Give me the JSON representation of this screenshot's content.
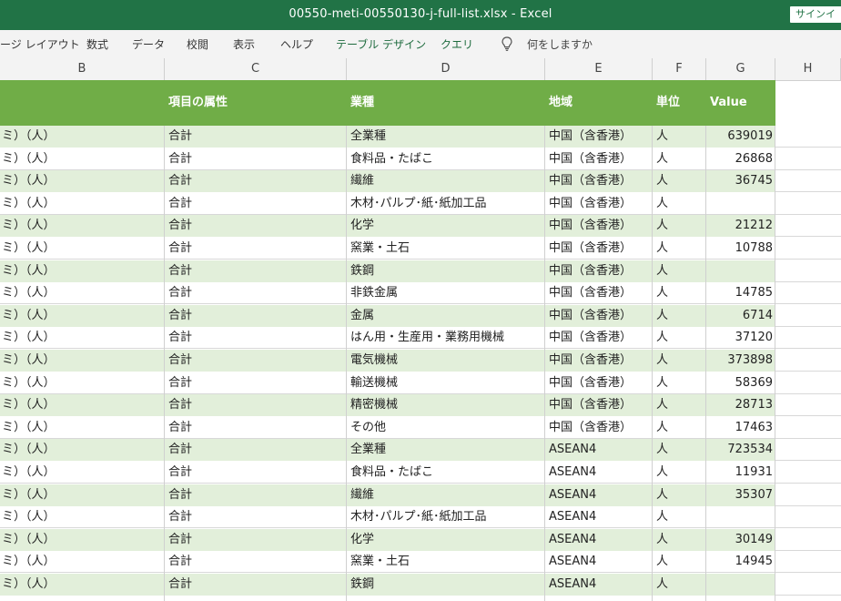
{
  "window": {
    "title": "00550-meti-00550130-j-full-list.xlsx  -  Excel",
    "signin_label": "サインイ"
  },
  "ribbon": {
    "tabs": [
      "ージ レイアウト",
      "数式",
      "データ",
      "校閲",
      "表示",
      "ヘルプ",
      "テーブル デザイン",
      "クエリ"
    ],
    "tell_me": "何をしますか",
    "lightbulb_icon": "lightbulb-icon"
  },
  "columns": [
    "B",
    "C",
    "D",
    "E",
    "F",
    "G",
    "H"
  ],
  "table": {
    "headers": {
      "attr": "項目の属性",
      "industry": "業種",
      "region": "地域",
      "unit": "単位",
      "value": "Value"
    },
    "rows": [
      {
        "b": "ミ）（人）",
        "c": "合計",
        "d": "全業種",
        "e": "中国（含香港）",
        "f": "人",
        "g": "639019"
      },
      {
        "b": "ミ）（人）",
        "c": "合計",
        "d": "食料品・たばこ",
        "e": "中国（含香港）",
        "f": "人",
        "g": "26868"
      },
      {
        "b": "ミ）（人）",
        "c": "合計",
        "d": "繊維",
        "e": "中国（含香港）",
        "f": "人",
        "g": "36745"
      },
      {
        "b": "ミ）（人）",
        "c": "合計",
        "d": "木材･パルプ･紙･紙加工品",
        "e": "中国（含香港）",
        "f": "人",
        "g": ""
      },
      {
        "b": "ミ）（人）",
        "c": "合計",
        "d": "化学",
        "e": "中国（含香港）",
        "f": "人",
        "g": "21212"
      },
      {
        "b": "ミ）（人）",
        "c": "合計",
        "d": "窯業・土石",
        "e": "中国（含香港）",
        "f": "人",
        "g": "10788"
      },
      {
        "b": "ミ）（人）",
        "c": "合計",
        "d": "鉄鋼",
        "e": "中国（含香港）",
        "f": "人",
        "g": ""
      },
      {
        "b": "ミ）（人）",
        "c": "合計",
        "d": "非鉄金属",
        "e": "中国（含香港）",
        "f": "人",
        "g": "14785"
      },
      {
        "b": "ミ）（人）",
        "c": "合計",
        "d": "金属",
        "e": "中国（含香港）",
        "f": "人",
        "g": "6714"
      },
      {
        "b": "ミ）（人）",
        "c": "合計",
        "d": "はん用・生産用・業務用機械",
        "e": "中国（含香港）",
        "f": "人",
        "g": "37120"
      },
      {
        "b": "ミ）（人）",
        "c": "合計",
        "d": "電気機械",
        "e": "中国（含香港）",
        "f": "人",
        "g": "373898"
      },
      {
        "b": "ミ）（人）",
        "c": "合計",
        "d": "輸送機械",
        "e": "中国（含香港）",
        "f": "人",
        "g": "58369"
      },
      {
        "b": "ミ）（人）",
        "c": "合計",
        "d": "精密機械",
        "e": "中国（含香港）",
        "f": "人",
        "g": "28713"
      },
      {
        "b": "ミ）（人）",
        "c": "合計",
        "d": "その他",
        "e": "中国（含香港）",
        "f": "人",
        "g": "17463"
      },
      {
        "b": "ミ）（人）",
        "c": "合計",
        "d": "全業種",
        "e": "ASEAN4",
        "f": "人",
        "g": "723534"
      },
      {
        "b": "ミ）（人）",
        "c": "合計",
        "d": "食料品・たばこ",
        "e": "ASEAN4",
        "f": "人",
        "g": "11931"
      },
      {
        "b": "ミ）（人）",
        "c": "合計",
        "d": "繊維",
        "e": "ASEAN4",
        "f": "人",
        "g": "35307"
      },
      {
        "b": "ミ）（人）",
        "c": "合計",
        "d": "木材･パルプ･紙･紙加工品",
        "e": "ASEAN4",
        "f": "人",
        "g": ""
      },
      {
        "b": "ミ）（人）",
        "c": "合計",
        "d": "化学",
        "e": "ASEAN4",
        "f": "人",
        "g": "30149"
      },
      {
        "b": "ミ）（人）",
        "c": "合計",
        "d": "窯業・土石",
        "e": "ASEAN4",
        "f": "人",
        "g": "14945"
      },
      {
        "b": "ミ）（人）",
        "c": "合計",
        "d": "鉄鋼",
        "e": "ASEAN4",
        "f": "人",
        "g": ""
      }
    ]
  },
  "colors": {
    "titlebar": "#217346",
    "header_fill": "#70ad47",
    "band_fill": "#e2efda"
  }
}
